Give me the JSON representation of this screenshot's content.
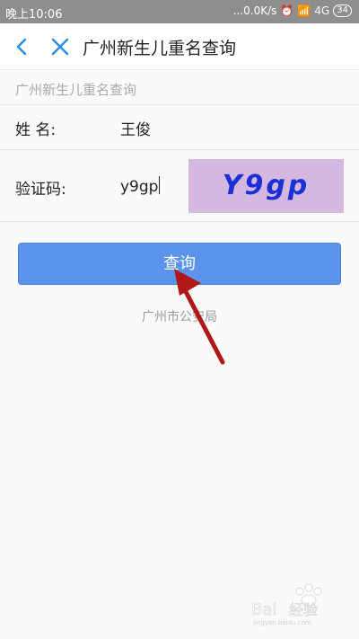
{
  "status_bar": {
    "time": "晚上10:06",
    "network_speed": "...0.0K/s",
    "signal": "4G",
    "battery": "34"
  },
  "nav": {
    "title": "广州新生儿重名查询"
  },
  "subtitle": "广州新生儿重名查询",
  "form": {
    "name_label": "姓 名:",
    "name_value": "王俊",
    "captcha_label": "验证码:",
    "captcha_value": "y9gp",
    "captcha_image_text": "Y9gp"
  },
  "query_button_label": "查询",
  "footer": "广州市公安局",
  "colors": {
    "accent": "#5b94ea",
    "captcha_bg": "#d5b8e0",
    "captcha_text": "#1a2fd6",
    "arrow": "#b01818"
  }
}
